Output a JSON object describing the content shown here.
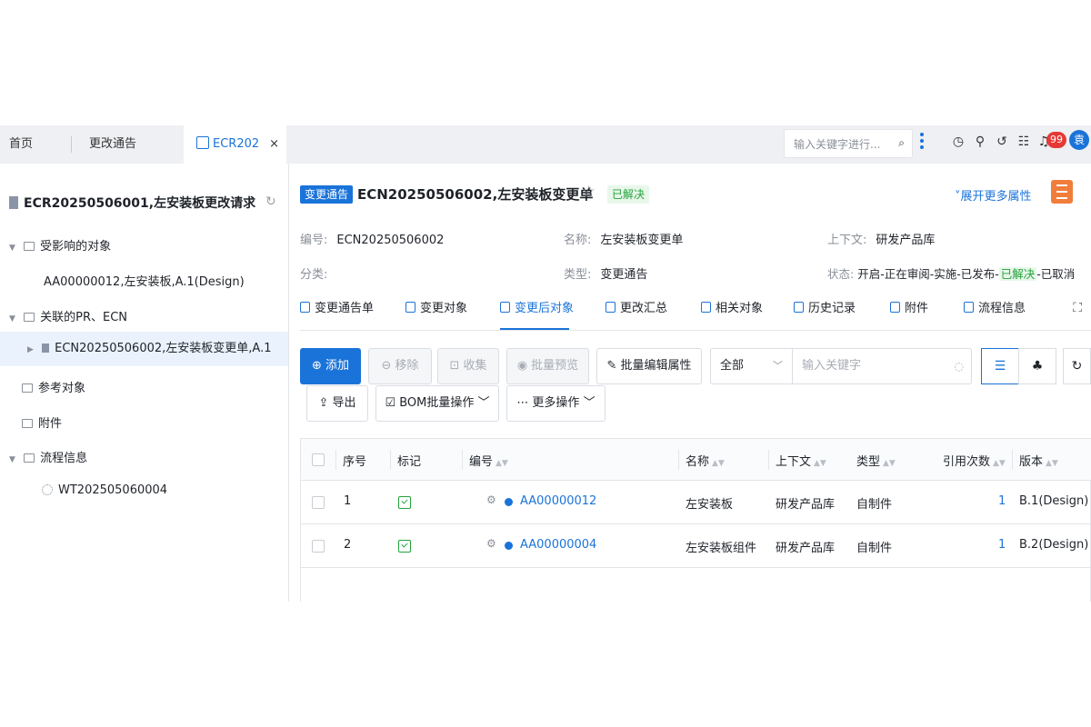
{
  "topbar": {
    "tabs": [
      {
        "label": "首页"
      },
      {
        "label": "更改通告"
      },
      {
        "label": "ECR202",
        "close": "×"
      }
    ],
    "search_placeholder": "输入关键字进行...",
    "search_icon": "⌕",
    "notification_count": "99",
    "avatar_text": "袁"
  },
  "tree": {
    "root": "ECR20250506001,左安装板更改请求",
    "nodes": {
      "affected": "受影响的对象",
      "affected_child": "AA00000012,左安装板,A.1(Design)",
      "related": "关联的PR、ECN",
      "related_child": "ECN20250506002,左安装板变更单,A.1",
      "reference": "参考对象",
      "attachment": "附件",
      "workflow": "流程信息",
      "workflow_child": "WT202505060004"
    }
  },
  "header": {
    "tag": "变更通告",
    "title": "ECN20250506002,左安装板变更单",
    "status": "已解决",
    "expand": "展开更多属性"
  },
  "props": {
    "number_label": "编号:",
    "number": "ECN20250506002",
    "name_label": "名称:",
    "name": "左安装板变更单",
    "context_label": "上下文:",
    "context": "研发产品库",
    "category_label": "分类:",
    "type_label": "类型:",
    "type": "变更通告",
    "state_label": "状态:",
    "state_pre": "开启-正在审阅-实施-已发布-",
    "state_current": "已解决",
    "state_post": "-已取消"
  },
  "subtabs": [
    {
      "label": "变更通告单"
    },
    {
      "label": "变更对象"
    },
    {
      "label": "变更后对象"
    },
    {
      "label": "更改汇总"
    },
    {
      "label": "相关对象"
    },
    {
      "label": "历史记录"
    },
    {
      "label": "附件"
    },
    {
      "label": "流程信息"
    }
  ],
  "toolbar": {
    "add": "添加",
    "remove": "移除",
    "collect": "收集",
    "batch_preview": "批量预览",
    "batch_edit": "批量编辑属性",
    "filter": "全部",
    "keyword_placeholder": "输入关键字",
    "export": "导出",
    "bom_batch": "BOM批量操作",
    "more": "更多操作"
  },
  "table": {
    "headers": [
      "序号",
      "标记",
      "编号",
      "名称",
      "上下文",
      "类型",
      "引用次数",
      "版本"
    ],
    "rows": [
      {
        "index": "1",
        "number": "AA00000012",
        "name": "左安装板",
        "context": "研发产品库",
        "type": "自制件",
        "refs": "1",
        "version": "B.1(Design)"
      },
      {
        "index": "2",
        "number": "AA00000004",
        "name": "左安装板组件",
        "context": "研发产品库",
        "type": "自制件",
        "refs": "1",
        "version": "B.2(Design)"
      }
    ]
  },
  "colors": {
    "accent": "#1a73d9",
    "success": "#22a33a",
    "orange": "#f07d3a"
  }
}
